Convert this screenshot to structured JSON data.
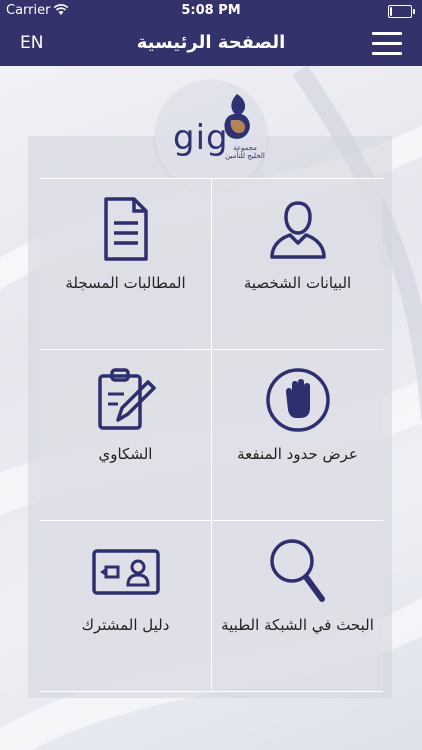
{
  "status_bar": {
    "carrier": "Carrier",
    "time": "5:08 PM",
    "battery_level": 0.1
  },
  "nav": {
    "language_label": "EN",
    "title": "الصفحة الرئيسية"
  },
  "logo": {
    "text": "gig",
    "tagline": "مجموعة الخليج للتأمين"
  },
  "menu": {
    "personal_data": "البيانات الشخصية",
    "registered_claims": "المطالبات المسجلة",
    "benefit_limits": "عرض حدود المنفعة",
    "complaints": "الشكاوي",
    "medical_network_search": "البحث في الشبكة الطبية",
    "member_guide": "دليل المشترك"
  },
  "colors": {
    "brand_navy": "#34326b",
    "icon_navy": "#2d2f6e",
    "logo_copper": "#b5835a"
  },
  "icons": [
    "wifi-icon",
    "battery-icon",
    "menu-icon",
    "person-icon",
    "document-icon",
    "hand-stop-icon",
    "clipboard-pencil-icon",
    "magnifier-icon",
    "member-card-icon"
  ]
}
